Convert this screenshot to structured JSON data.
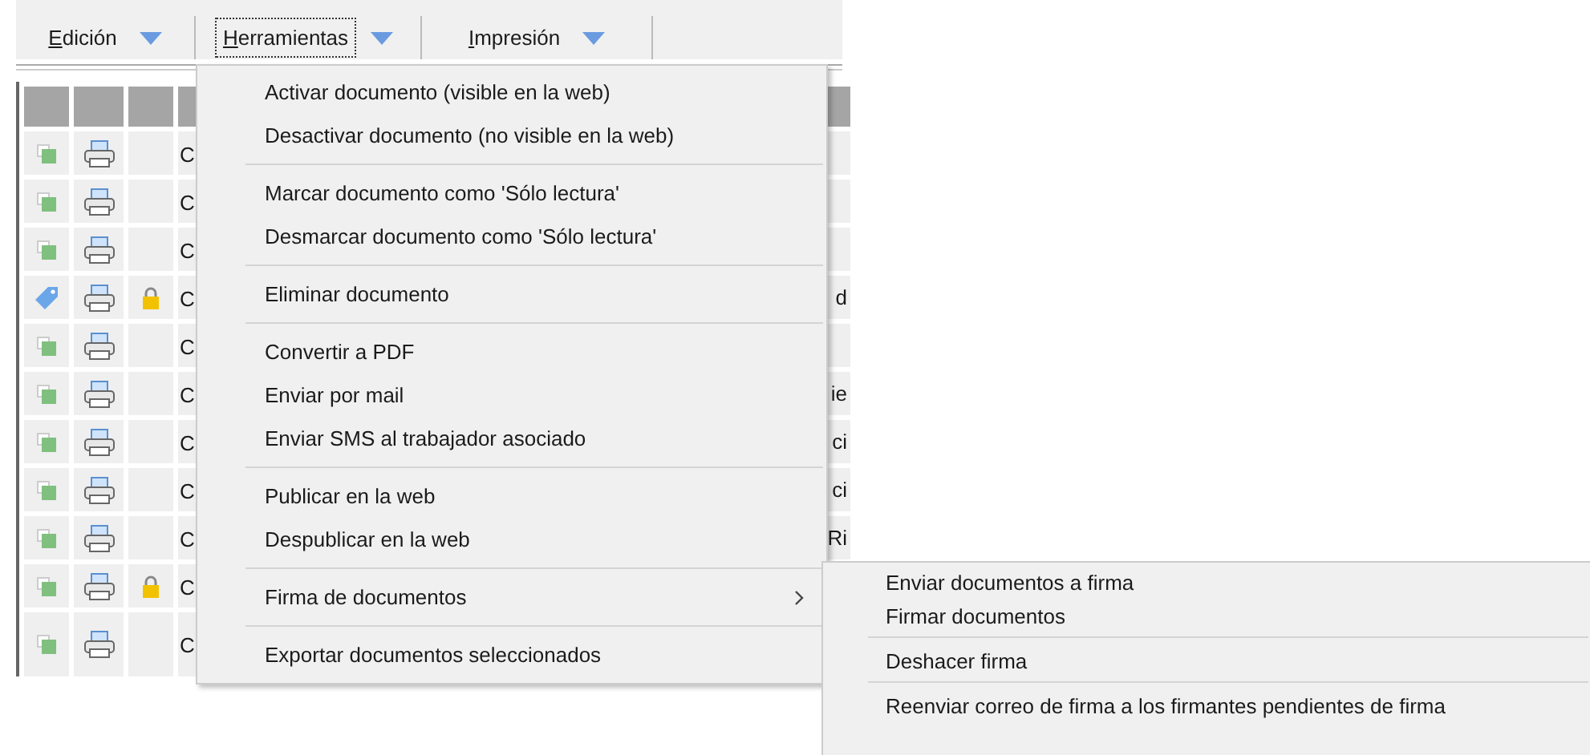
{
  "toolbar": [
    {
      "label": "Edición",
      "focused": false
    },
    {
      "label": "Herramientas",
      "focused": true
    },
    {
      "label": "Impresión",
      "focused": false
    }
  ],
  "table": {
    "rows": [
      {
        "kind": "square",
        "locked": false,
        "text": "C",
        "tail": ""
      },
      {
        "kind": "square",
        "locked": false,
        "text": "C",
        "tail": ""
      },
      {
        "kind": "square",
        "locked": false,
        "text": "C",
        "tail": ""
      },
      {
        "kind": "tag",
        "locked": true,
        "text": "C",
        "tail": "d"
      },
      {
        "kind": "square",
        "locked": false,
        "text": "C",
        "tail": ""
      },
      {
        "kind": "square",
        "locked": false,
        "text": "C",
        "tail": "ie"
      },
      {
        "kind": "square",
        "locked": false,
        "text": "C",
        "tail": "ci"
      },
      {
        "kind": "square",
        "locked": false,
        "text": "C",
        "tail": "ci"
      },
      {
        "kind": "square",
        "locked": false,
        "text": "C",
        "tail": "Ri"
      },
      {
        "kind": "square",
        "locked": true,
        "text": "C",
        "tail": ""
      },
      {
        "kind": "square",
        "locked": false,
        "text": "C",
        "tail": ""
      }
    ]
  },
  "menu": {
    "items": [
      {
        "kind": "item",
        "label": "Activar documento (visible en la web)"
      },
      {
        "kind": "item",
        "label": "Desactivar documento (no visible en la web)"
      },
      {
        "kind": "separator"
      },
      {
        "kind": "item",
        "label": "Marcar documento como 'Sólo lectura'"
      },
      {
        "kind": "item",
        "label": "Desmarcar documento como 'Sólo lectura'"
      },
      {
        "kind": "separator"
      },
      {
        "kind": "item",
        "label": "Eliminar documento"
      },
      {
        "kind": "separator"
      },
      {
        "kind": "item",
        "label": "Convertir a PDF"
      },
      {
        "kind": "item",
        "label": "Enviar por mail"
      },
      {
        "kind": "item",
        "label": "Enviar SMS al trabajador asociado"
      },
      {
        "kind": "separator"
      },
      {
        "kind": "item",
        "label": "Publicar en la web"
      },
      {
        "kind": "item",
        "label": "Despublicar en la web"
      },
      {
        "kind": "separator"
      },
      {
        "kind": "submenu",
        "label": "Firma de documentos",
        "expanded": true
      },
      {
        "kind": "separator"
      },
      {
        "kind": "item",
        "label": "Exportar documentos seleccionados"
      }
    ]
  },
  "submenu": {
    "items": [
      {
        "kind": "item",
        "label": "Enviar documentos a firma"
      },
      {
        "kind": "item",
        "label": "Firmar documentos"
      },
      {
        "kind": "separator"
      },
      {
        "kind": "item",
        "label": "Deshacer firma"
      },
      {
        "kind": "separator"
      },
      {
        "kind": "item",
        "label": "Reenviar correo de firma a los firmantes pendientes de firma"
      }
    ]
  }
}
